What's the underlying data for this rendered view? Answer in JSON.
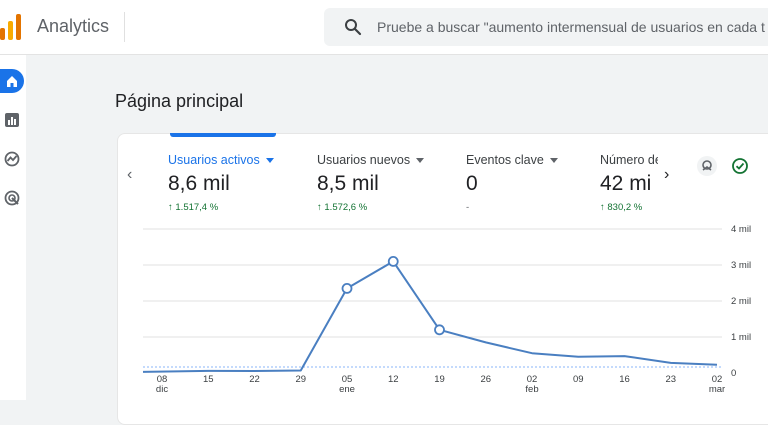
{
  "app": {
    "title": "Analytics"
  },
  "search": {
    "placeholder": "Pruebe a buscar \"aumento intermensual de usuarios en cada t"
  },
  "sidebar": {
    "items": [
      {
        "icon": "home-icon"
      },
      {
        "icon": "reports-icon"
      },
      {
        "icon": "explore-icon"
      },
      {
        "icon": "advertising-icon"
      }
    ]
  },
  "page": {
    "title": "Página principal"
  },
  "metrics": [
    {
      "label": "Usuarios activos",
      "value": "8,6 mil",
      "change": "1.517,4 %"
    },
    {
      "label": "Usuarios nuevos",
      "value": "8,5 mil",
      "change": "1.572,6 %"
    },
    {
      "label": "Eventos clave",
      "value": "0",
      "change": "-"
    },
    {
      "label": "Número de",
      "value": "42 mi",
      "change": "830,2 %"
    }
  ],
  "nav_arrows": {
    "prev": "‹",
    "next": "›"
  },
  "up_arrow": "↑",
  "colors": {
    "accent": "#1a73e8",
    "positive": "#137333"
  },
  "chart_data": {
    "type": "line",
    "x": [
      "08 dic",
      "15",
      "22",
      "29",
      "05 ene",
      "12",
      "19",
      "26",
      "02 feb",
      "09",
      "16",
      "23",
      "02 mar"
    ],
    "x_ticks": [
      {
        "day": "08",
        "month": "dic"
      },
      {
        "day": "15",
        "month": ""
      },
      {
        "day": "22",
        "month": ""
      },
      {
        "day": "29",
        "month": ""
      },
      {
        "day": "05",
        "month": "ene"
      },
      {
        "day": "12",
        "month": ""
      },
      {
        "day": "19",
        "month": ""
      },
      {
        "day": "26",
        "month": ""
      },
      {
        "day": "02",
        "month": "feb"
      },
      {
        "day": "09",
        "month": ""
      },
      {
        "day": "16",
        "month": ""
      },
      {
        "day": "23",
        "month": ""
      },
      {
        "day": "02",
        "month": "mar"
      }
    ],
    "y_ticks": [
      "0",
      "1 mil",
      "2 mil",
      "3 mil",
      "4 mil"
    ],
    "ylim": [
      0,
      4000
    ],
    "grid": true,
    "series": [
      {
        "values": [
          30,
          60,
          55,
          70,
          2350,
          3100,
          1200,
          850,
          550,
          450,
          470,
          280,
          230
        ],
        "markers": [
          false,
          false,
          false,
          false,
          true,
          true,
          true,
          false,
          false,
          false,
          false,
          false,
          false
        ]
      }
    ]
  }
}
